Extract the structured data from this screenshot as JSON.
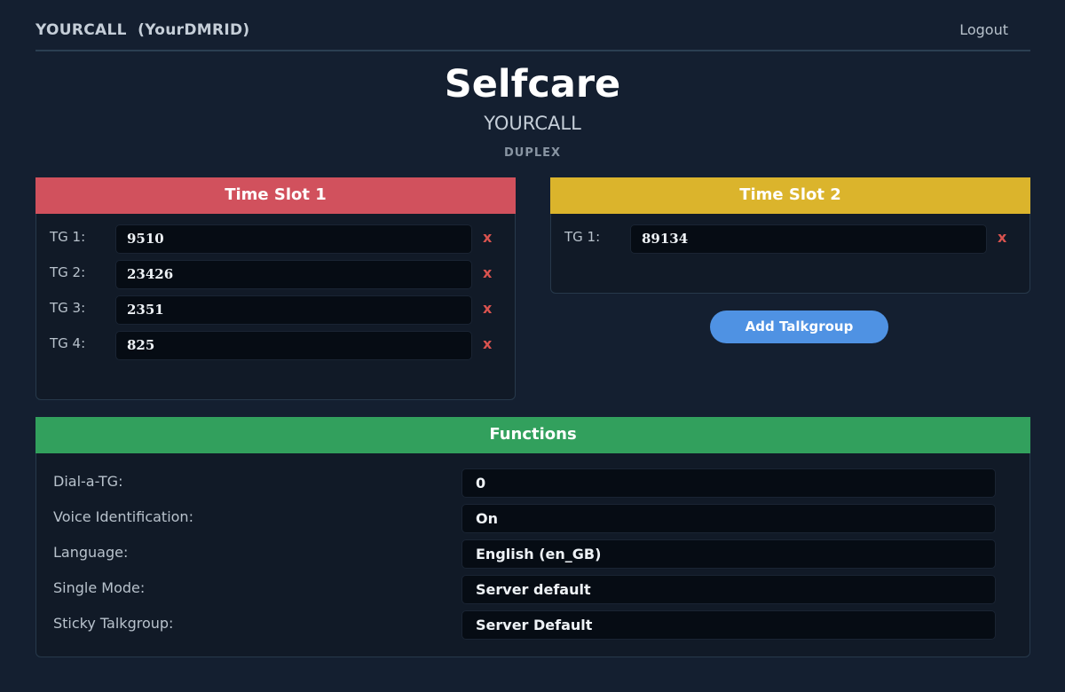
{
  "header": {
    "callsign": "YOURCALL  (YourDMRID)",
    "logout_label": "Logout"
  },
  "page": {
    "title": "Selfcare",
    "subtitle": "YOURCALL",
    "mode": "DUPLEX"
  },
  "timeslot1": {
    "title": "Time Slot 1",
    "color": "#d1515d",
    "talkgroups": [
      {
        "label": "TG 1:",
        "value": "9510",
        "delete": "x"
      },
      {
        "label": "TG 2:",
        "value": "23426",
        "delete": "x"
      },
      {
        "label": "TG 3:",
        "value": "2351",
        "delete": "x"
      },
      {
        "label": "TG 4:",
        "value": "825",
        "delete": "x"
      }
    ]
  },
  "timeslot2": {
    "title": "Time Slot 2",
    "color": "#dbb42c",
    "talkgroups": [
      {
        "label": "TG 1:",
        "value": "89134",
        "delete": "x"
      }
    ]
  },
  "add_button_label": "Add Talkgroup",
  "functions": {
    "title": "Functions",
    "color": "#32a05d",
    "rows": [
      {
        "label": "Dial-a-TG:",
        "value": "0"
      },
      {
        "label": "Voice Identification:",
        "value": "On"
      },
      {
        "label": "Language:",
        "value": "English (en_GB)"
      },
      {
        "label": "Single Mode:",
        "value": "Server default"
      },
      {
        "label": "Sticky Talkgroup:",
        "value": "Server Default"
      }
    ]
  }
}
